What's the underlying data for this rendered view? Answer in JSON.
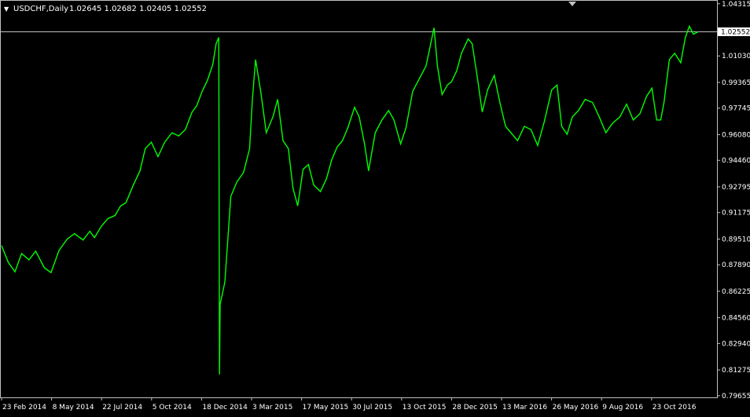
{
  "header": {
    "arrow": "▼",
    "symbol_timeframe": "USDCHF,Daily",
    "ohlc": "1.02645 1.02682 1.02405 1.02552"
  },
  "current_price_label": "1.02552",
  "colors": {
    "background": "#000000",
    "candles": "#00ff00",
    "axis": "#c0c0c0",
    "text": "#ffffff",
    "current_price_line": "#c0c0c0",
    "current_price_tag_bg": "#ffffff",
    "current_price_tag_text": "#000000"
  },
  "chart_data": {
    "type": "line",
    "title": "USDCHF,Daily",
    "xlabel": "",
    "ylabel": "",
    "grid": false,
    "ylim": [
      0.7955,
      1.0455
    ],
    "y_ticks": [
      "1.04315",
      "1.02552",
      "1.01030",
      "0.99365",
      "0.97745",
      "0.96080",
      "0.94460",
      "0.92795",
      "0.91175",
      "0.89510",
      "0.87890",
      "0.86225",
      "0.84560",
      "0.82940",
      "0.81275",
      "0.79655"
    ],
    "x_tick_labels": [
      "23 Feb 2014",
      "8 May 2014",
      "22 Jul 2014",
      "5 Oct 2014",
      "18 Dec 2014",
      "3 Mar 2015",
      "17 May 2015",
      "30 Jul 2015",
      "13 Oct 2015",
      "28 Dec 2015",
      "13 Mar 2016",
      "26 May 2016",
      "9 Aug 2016",
      "23 Oct 2016"
    ],
    "x_range": [
      "2014-02-23",
      "2016-12-31"
    ],
    "current_price": 1.02552,
    "series": [
      {
        "name": "USDCHF",
        "values": [
          [
            "2014-02-23",
            0.891
          ],
          [
            "2014-03-05",
            0.8805
          ],
          [
            "2014-03-15",
            0.8745
          ],
          [
            "2014-03-25",
            0.886
          ],
          [
            "2014-04-05",
            0.882
          ],
          [
            "2014-04-15",
            0.8875
          ],
          [
            "2014-04-28",
            0.877
          ],
          [
            "2014-05-08",
            0.874
          ],
          [
            "2014-05-20",
            0.888
          ],
          [
            "2014-06-01",
            0.895
          ],
          [
            "2014-06-12",
            0.8985
          ],
          [
            "2014-06-25",
            0.8945
          ],
          [
            "2014-07-05",
            0.9
          ],
          [
            "2014-07-12",
            0.896
          ],
          [
            "2014-07-22",
            0.903
          ],
          [
            "2014-08-01",
            0.908
          ],
          [
            "2014-08-12",
            0.91
          ],
          [
            "2014-08-20",
            0.916
          ],
          [
            "2014-08-28",
            0.918
          ],
          [
            "2014-09-08",
            0.929
          ],
          [
            "2014-09-18",
            0.938
          ],
          [
            "2014-09-26",
            0.952
          ],
          [
            "2014-10-05",
            0.956
          ],
          [
            "2014-10-15",
            0.947
          ],
          [
            "2014-10-25",
            0.956
          ],
          [
            "2014-11-05",
            0.962
          ],
          [
            "2014-11-15",
            0.96
          ],
          [
            "2014-11-25",
            0.964
          ],
          [
            "2014-12-05",
            0.975
          ],
          [
            "2014-12-12",
            0.979
          ],
          [
            "2014-12-20",
            0.988
          ],
          [
            "2014-12-28",
            0.995
          ],
          [
            "2015-01-05",
            1.005
          ],
          [
            "2015-01-10",
            1.018
          ],
          [
            "2015-01-14",
            1.022
          ],
          [
            "2015-01-15",
            0.81
          ],
          [
            "2015-01-16",
            0.854
          ],
          [
            "2015-01-23",
            0.868
          ],
          [
            "2015-02-01",
            0.922
          ],
          [
            "2015-02-10",
            0.931
          ],
          [
            "2015-02-20",
            0.937
          ],
          [
            "2015-03-01",
            0.952
          ],
          [
            "2015-03-05",
            0.982
          ],
          [
            "2015-03-10",
            1.008
          ],
          [
            "2015-03-18",
            0.987
          ],
          [
            "2015-03-26",
            0.962
          ],
          [
            "2015-04-05",
            0.972
          ],
          [
            "2015-04-12",
            0.983
          ],
          [
            "2015-04-20",
            0.957
          ],
          [
            "2015-04-28",
            0.952
          ],
          [
            "2015-05-05",
            0.927
          ],
          [
            "2015-05-12",
            0.916
          ],
          [
            "2015-05-20",
            0.939
          ],
          [
            "2015-05-28",
            0.942
          ],
          [
            "2015-06-05",
            0.929
          ],
          [
            "2015-06-15",
            0.925
          ],
          [
            "2015-06-24",
            0.933
          ],
          [
            "2015-07-02",
            0.945
          ],
          [
            "2015-07-10",
            0.953
          ],
          [
            "2015-07-18",
            0.957
          ],
          [
            "2015-07-26",
            0.965
          ],
          [
            "2015-08-05",
            0.978
          ],
          [
            "2015-08-12",
            0.972
          ],
          [
            "2015-08-20",
            0.955
          ],
          [
            "2015-08-26",
            0.938
          ],
          [
            "2015-09-05",
            0.962
          ],
          [
            "2015-09-15",
            0.97
          ],
          [
            "2015-09-25",
            0.976
          ],
          [
            "2015-10-03",
            0.97
          ],
          [
            "2015-10-13",
            0.955
          ],
          [
            "2015-10-21",
            0.965
          ],
          [
            "2015-10-31",
            0.988
          ],
          [
            "2015-11-10",
            0.996
          ],
          [
            "2015-11-20",
            1.004
          ],
          [
            "2015-11-27",
            1.018
          ],
          [
            "2015-12-02",
            1.028
          ],
          [
            "2015-12-07",
            1.004
          ],
          [
            "2015-12-14",
            0.986
          ],
          [
            "2015-12-22",
            0.992
          ],
          [
            "2015-12-28",
            0.994
          ],
          [
            "2016-01-05",
            1.001
          ],
          [
            "2016-01-12",
            1.012
          ],
          [
            "2016-01-22",
            1.021
          ],
          [
            "2016-01-28",
            1.018
          ],
          [
            "2016-02-05",
            0.996
          ],
          [
            "2016-02-12",
            0.975
          ],
          [
            "2016-02-20",
            0.989
          ],
          [
            "2016-03-01",
            0.998
          ],
          [
            "2016-03-10",
            0.98
          ],
          [
            "2016-03-18",
            0.966
          ],
          [
            "2016-03-26",
            0.962
          ],
          [
            "2016-04-05",
            0.957
          ],
          [
            "2016-04-15",
            0.966
          ],
          [
            "2016-04-25",
            0.964
          ],
          [
            "2016-05-05",
            0.954
          ],
          [
            "2016-05-15",
            0.969
          ],
          [
            "2016-05-26",
            0.989
          ],
          [
            "2016-06-03",
            0.992
          ],
          [
            "2016-06-10",
            0.966
          ],
          [
            "2016-06-18",
            0.961
          ],
          [
            "2016-06-26",
            0.972
          ],
          [
            "2016-07-05",
            0.976
          ],
          [
            "2016-07-15",
            0.983
          ],
          [
            "2016-07-26",
            0.981
          ],
          [
            "2016-08-05",
            0.972
          ],
          [
            "2016-08-15",
            0.962
          ],
          [
            "2016-08-25",
            0.968
          ],
          [
            "2016-09-05",
            0.972
          ],
          [
            "2016-09-15",
            0.98
          ],
          [
            "2016-09-25",
            0.97
          ],
          [
            "2016-10-05",
            0.974
          ],
          [
            "2016-10-15",
            0.985
          ],
          [
            "2016-10-23",
            0.99
          ],
          [
            "2016-10-30",
            0.97
          ],
          [
            "2016-11-05",
            0.97
          ],
          [
            "2016-11-10",
            0.981
          ],
          [
            "2016-11-18",
            1.008
          ],
          [
            "2016-11-26",
            1.012
          ],
          [
            "2016-12-05",
            1.006
          ],
          [
            "2016-12-12",
            1.022
          ],
          [
            "2016-12-18",
            1.029
          ],
          [
            "2016-12-24",
            1.024
          ],
          [
            "2016-12-31",
            1.0255
          ]
        ]
      }
    ]
  }
}
